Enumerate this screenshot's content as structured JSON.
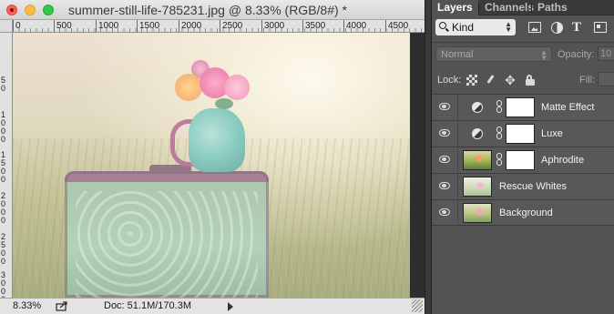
{
  "document": {
    "title": "summer-still-life-785231.jpg @ 8.33% (RGB/8#) *",
    "ruler_h_labels": [
      "0",
      "500",
      "1000",
      "1500",
      "2000",
      "2500",
      "3000",
      "3500",
      "4000",
      "4500"
    ],
    "ruler_v_labels": [
      "5 0",
      "1 0 0 0",
      "1 5 0 0",
      "2 0 0 0",
      "2 5 0 0",
      "3 0 0 0"
    ],
    "status": {
      "zoom": "8.33%",
      "doc_size": "Doc: 51.1M/170.3M"
    }
  },
  "panel": {
    "tabs": [
      "Layers",
      "Channels",
      "Paths"
    ],
    "active_tab": "Layers",
    "filter": {
      "kind_label": "Kind",
      "icons": [
        "image-filter-icon",
        "adjustment-filter-icon",
        "type-filter-icon",
        "shape-filter-icon"
      ]
    },
    "blend_mode": "Normal",
    "opacity_label": "Opacity:",
    "opacity_value": "10",
    "lock_label": "Lock:",
    "fill_label": "Fill:",
    "layers": [
      {
        "name": "Matte Effect",
        "kind": "adjustment",
        "has_mask": true
      },
      {
        "name": "Luxe",
        "kind": "adjustment",
        "has_mask": true
      },
      {
        "name": "Aphrodite",
        "kind": "image",
        "has_mask": true
      },
      {
        "name": "Rescue Whites",
        "kind": "image",
        "has_mask": false
      },
      {
        "name": "Background",
        "kind": "image",
        "has_mask": false
      }
    ]
  }
}
